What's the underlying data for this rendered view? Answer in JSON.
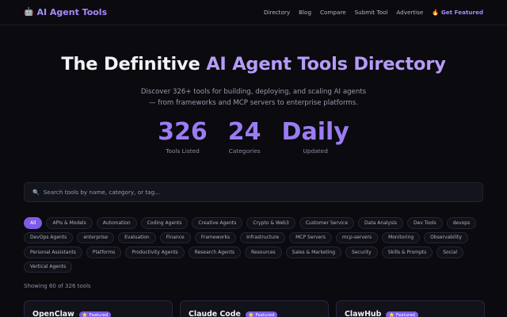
{
  "header": {
    "logo_icon": "🤖",
    "brand": "AI Agent Tools",
    "nav": [
      "Directory",
      "Blog",
      "Compare",
      "Submit Tool",
      "Advertise"
    ],
    "featured_icon": "🔥",
    "featured_label": "Get Featured"
  },
  "hero": {
    "title_white": "The Definitive ",
    "title_gradient": "AI Agent Tools Directory",
    "subtitle_line1": "Discover 326+ tools for building, deploying, and scaling AI agents",
    "subtitle_line2": "— from frameworks and MCP servers to enterprise platforms.",
    "stats": [
      {
        "value": "326",
        "label": "Tools Listed"
      },
      {
        "value": "24",
        "label": "Categories"
      },
      {
        "value": "Daily",
        "label": "Updated"
      }
    ]
  },
  "search": {
    "icon": "🔍",
    "placeholder": "Search tools by name, category, or tag..."
  },
  "categories": [
    "All",
    "APIs & Models",
    "Automation",
    "Coding Agents",
    "Creative Agents",
    "Crypto & Web3",
    "Customer Service",
    "Data Analysis",
    "Dev Tools",
    "devops",
    "DevOps Agents",
    "enterprise",
    "Evaluation",
    "Finance",
    "Frameworks",
    "Infrastructure",
    "MCP Servers",
    "mcp-servers",
    "Monitoring",
    "Observability",
    "Personal Assistants",
    "Platforms",
    "Productivity Agents",
    "Research Agents",
    "Resources",
    "Sales & Marketing",
    "Security",
    "Skills & Prompts",
    "Social",
    "Vertical Agents"
  ],
  "active_category": "All",
  "showing_text": "Showing 60 of 326 tools",
  "cards": [
    {
      "name": "OpenClaw",
      "badge_icon": "⭐",
      "badge": "Featured"
    },
    {
      "name": "Claude Code",
      "badge_icon": "⭐",
      "badge": "Featured"
    },
    {
      "name": "ClawHub",
      "badge_icon": "⭐",
      "badge": "Featured"
    }
  ],
  "colors": {
    "background": "#0a0a0f",
    "accent": "#7c5ce6",
    "stat_number": "#9b7cf3"
  }
}
